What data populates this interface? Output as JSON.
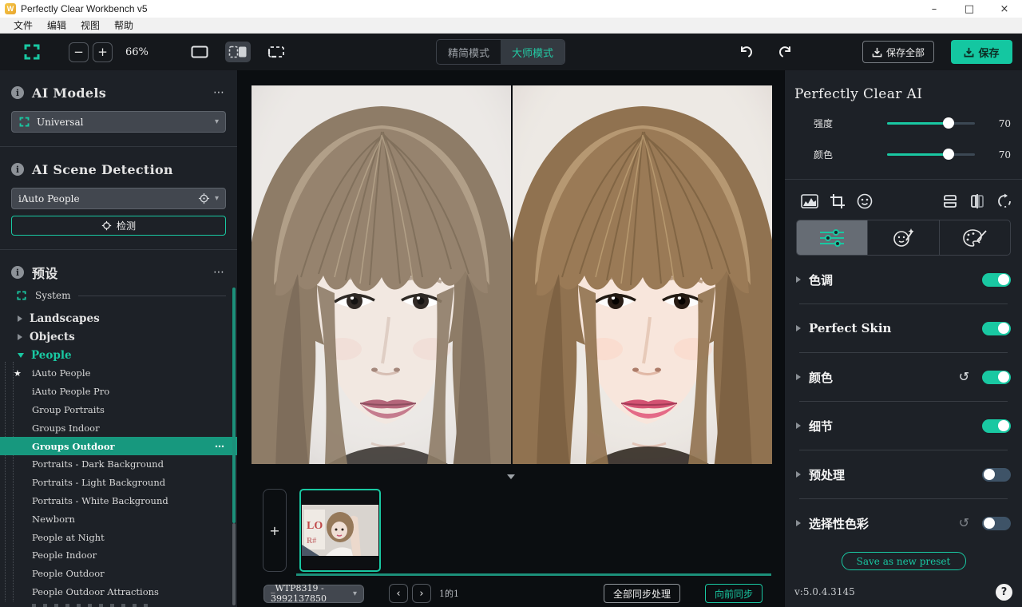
{
  "window": {
    "title": "Perfectly Clear Workbench v5",
    "controls": {
      "minimize": "–",
      "maximize": "□",
      "close": "×"
    }
  },
  "menu": {
    "items": [
      "文件",
      "编辑",
      "视图",
      "帮助"
    ]
  },
  "toolbar": {
    "zoom_out": "−",
    "zoom_in": "+",
    "zoom_level": "66%",
    "mode_simple": "精简模式",
    "mode_master": "大师模式",
    "save_all": "保存全部",
    "save": "保存"
  },
  "sidebar": {
    "ai_models": {
      "title": "AI Models",
      "selected": "Universal"
    },
    "scene_detection": {
      "title": "AI Scene Detection",
      "selected": "iAuto People",
      "detect": "检测"
    },
    "presets": {
      "title": "预设",
      "system": "System",
      "groups": {
        "landscapes": "Landscapes",
        "objects": "Objects",
        "people": "People"
      },
      "items": [
        "iAuto People",
        "iAuto People Pro",
        "Group Portraits",
        "Groups Indoor",
        "Groups Outdoor",
        "Portraits - Dark Background",
        "Portraits - Light Background",
        "Portraits - White Background",
        "Newborn",
        "People at Night",
        "People Indoor",
        "People Outdoor",
        "People Outdoor Attractions"
      ],
      "selected_item": "Groups Outdoor"
    }
  },
  "viewer": {
    "add_label": "+",
    "file_name": "_WTP8319 - 3992137850",
    "nav_prev": "‹",
    "nav_next": "›",
    "page_indicator": "1的1",
    "sync_all": "全部同步处理",
    "sync_forward": "向前同步"
  },
  "panel": {
    "title": "Perfectly Clear AI",
    "sliders": [
      {
        "label": "强度",
        "value": "70"
      },
      {
        "label": "颜色",
        "value": "70"
      }
    ],
    "sections": [
      {
        "label": "色调",
        "on": true
      },
      {
        "label": "Perfect Skin",
        "on": true
      },
      {
        "label": "颜色",
        "on": true,
        "reset": true
      },
      {
        "label": "细节",
        "on": true
      },
      {
        "label": "预处理",
        "on": false
      },
      {
        "label": "选择性色彩",
        "on": false,
        "reset": true
      }
    ],
    "reset_glyph": "↺",
    "save_preset": "Save as new preset",
    "version": "v:5.0.4.3145",
    "help": "?"
  },
  "icons": {
    "info": "i",
    "more": "⋯",
    "star": "★",
    "caret": "▾"
  },
  "colors": {
    "accent": "#19c8a2",
    "accent_selected_row": "#17987e",
    "save_button": "#14c7a1",
    "panel_bg": "#1d2127",
    "canvas_bg": "#0b0e11",
    "toggle_off": "#3e5367"
  }
}
